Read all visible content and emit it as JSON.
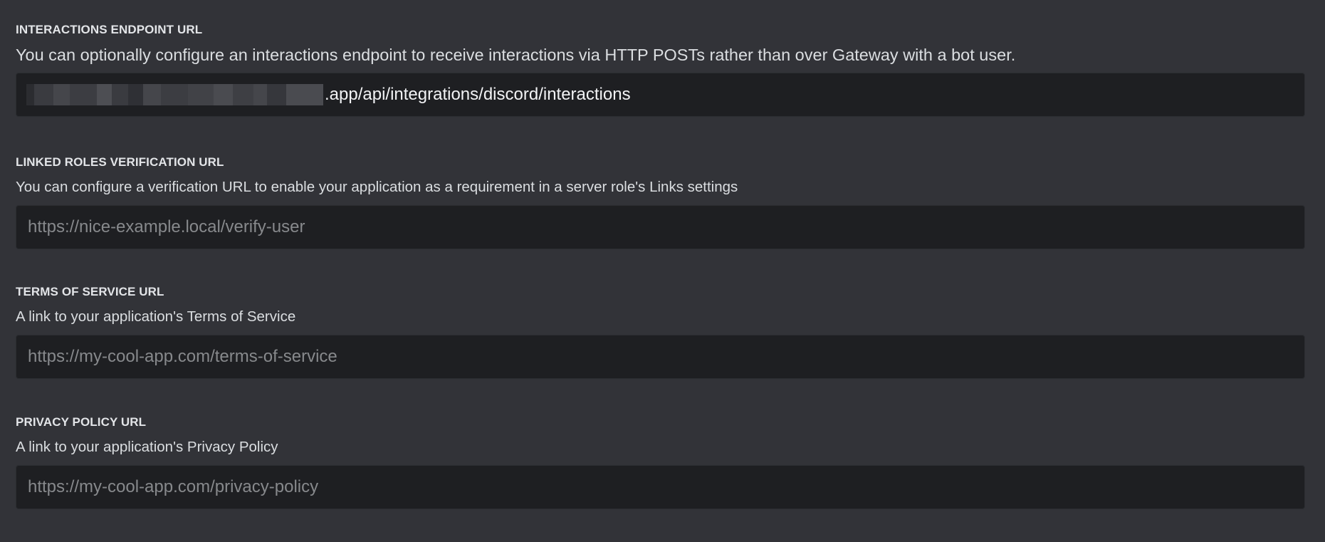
{
  "sections": [
    {
      "label": "INTERACTIONS ENDPOINT URL",
      "description": "You can optionally configure an interactions endpoint to receive interactions via HTTP POSTs rather than over Gateway with a bot user.",
      "value_suffix": ".app/api/integrations/discord/interactions",
      "redacted_prefix": true
    },
    {
      "label": "LINKED ROLES VERIFICATION URL",
      "description": "You can configure a verification URL to enable your application as a requirement in a server role's Links settings",
      "placeholder": "https://nice-example.local/verify-user"
    },
    {
      "label": "TERMS OF SERVICE URL",
      "description": "A link to your application's Terms of Service",
      "placeholder": "https://my-cool-app.com/terms-of-service"
    },
    {
      "label": "PRIVACY POLICY URL",
      "description": "A link to your application's Privacy Policy",
      "placeholder": "https://my-cool-app.com/privacy-policy"
    }
  ],
  "colors": {
    "background": "#323338",
    "input_background": "#1e1f22",
    "label": "#e3e5e8",
    "text": "#dbdee1",
    "placeholder": "#87898c"
  }
}
